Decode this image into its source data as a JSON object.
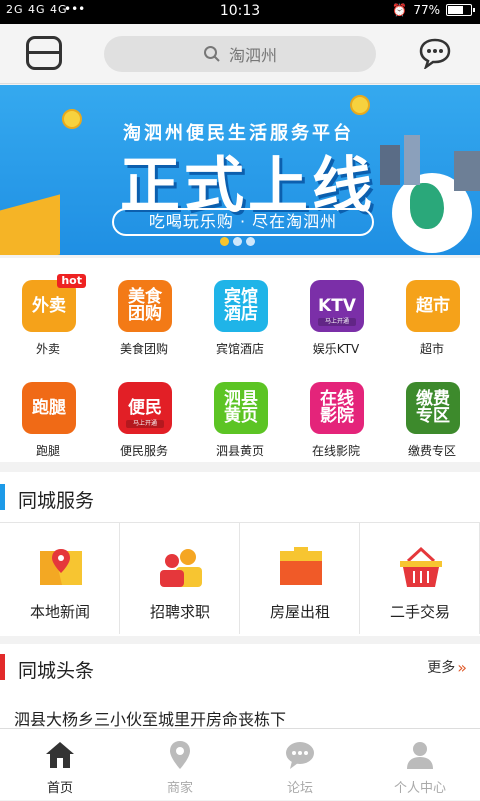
{
  "status_bar": {
    "signal": "2G 4G 4G",
    "dots": "•••",
    "time": "10:13",
    "battery": "77%",
    "battery_level": 0.77
  },
  "header": {
    "search_placeholder": "淘泗州"
  },
  "banner": {
    "subtitle": "淘泗州便民生活服务平台",
    "headline": "正式上线",
    "slogan": "吃喝玩乐购 · 尽在淘泗州",
    "slide_count": 3,
    "active_slide": 1
  },
  "categories": [
    {
      "tile": "外卖",
      "label": "外卖",
      "color": "#f5a21a",
      "badge": "hot"
    },
    {
      "tile": "美食团购",
      "label": "美食团购",
      "color": "#f37a16"
    },
    {
      "tile": "宾馆酒店",
      "label": "宾馆酒店",
      "color": "#1fb4e8"
    },
    {
      "tile": "KTV",
      "label": "娱乐KTV",
      "color": "#7b2fa8",
      "tag": "马上开通"
    },
    {
      "tile": "超市",
      "label": "超市",
      "color": "#f5a21a"
    },
    {
      "tile": "跑腿",
      "label": "跑腿",
      "color": "#f06a16"
    },
    {
      "tile": "便民",
      "label": "便民服务",
      "color": "#e21f26",
      "tag": "马上开通"
    },
    {
      "tile": "泗县黄页",
      "label": "泗县黄页",
      "color": "#5cc424"
    },
    {
      "tile": "在线影院",
      "label": "在线影院",
      "color": "#e4247a"
    },
    {
      "tile": "缴费专区",
      "label": "缴费专区",
      "color": "#3d8a2c"
    }
  ],
  "city_service": {
    "title": "同城服务",
    "accent": "#1d9ae8",
    "items": [
      {
        "label": "本地新闻",
        "icon": "map-pin-icon"
      },
      {
        "label": "招聘求职",
        "icon": "people-icon"
      },
      {
        "label": "房屋出租",
        "icon": "briefcase-icon"
      },
      {
        "label": "二手交易",
        "icon": "basket-icon"
      }
    ]
  },
  "headlines": {
    "title": "同城头条",
    "accent": "#e22a2a",
    "more": "更多",
    "items": [
      "泗县大杨乡三小伙至城里开房命丧栋下"
    ]
  },
  "tab_bar": [
    {
      "label": "首页",
      "icon": "home-icon",
      "active": true
    },
    {
      "label": "商家",
      "icon": "location-icon",
      "active": false
    },
    {
      "label": "论坛",
      "icon": "chat-icon",
      "active": false
    },
    {
      "label": "个人中心",
      "icon": "person-icon",
      "active": false
    }
  ]
}
